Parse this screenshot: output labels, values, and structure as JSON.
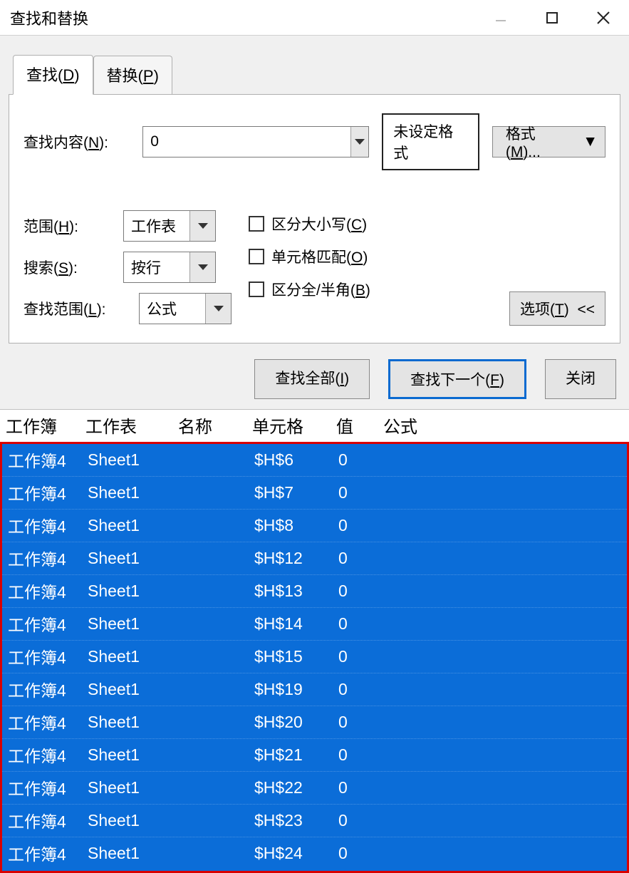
{
  "titlebar": {
    "title": "查找和替换"
  },
  "tabs": {
    "find": "查找(D)",
    "replace": "替换(P)"
  },
  "find": {
    "content_label": "查找内容(N):",
    "content_value": "0",
    "no_format_label": "未设定格式",
    "format_button": "格式(M)..."
  },
  "options": {
    "scope_label": "范围(H):",
    "scope_value": "工作表",
    "search_label": "搜索(S):",
    "search_value": "按行",
    "lookin_label": "查找范围(L):",
    "lookin_value": "公式",
    "chk_case": "区分大小写(C)",
    "chk_wholecell": "单元格匹配(O)",
    "chk_width": "区分全/半角(B)",
    "options_button": "选项(T)  <<"
  },
  "actions": {
    "find_all": "查找全部(I)",
    "find_next": "查找下一个(F)",
    "close": "关闭"
  },
  "results": {
    "headers": {
      "book": "工作簿",
      "sheet": "工作表",
      "name": "名称",
      "cell": "单元格",
      "value": "值",
      "formula": "公式"
    },
    "rows": [
      {
        "book": "工作簿4",
        "sheet": "Sheet1",
        "name": "",
        "cell": "$H$6",
        "value": "0",
        "formula": ""
      },
      {
        "book": "工作簿4",
        "sheet": "Sheet1",
        "name": "",
        "cell": "$H$7",
        "value": "0",
        "formula": ""
      },
      {
        "book": "工作簿4",
        "sheet": "Sheet1",
        "name": "",
        "cell": "$H$8",
        "value": "0",
        "formula": ""
      },
      {
        "book": "工作簿4",
        "sheet": "Sheet1",
        "name": "",
        "cell": "$H$12",
        "value": "0",
        "formula": ""
      },
      {
        "book": "工作簿4",
        "sheet": "Sheet1",
        "name": "",
        "cell": "$H$13",
        "value": "0",
        "formula": ""
      },
      {
        "book": "工作簿4",
        "sheet": "Sheet1",
        "name": "",
        "cell": "$H$14",
        "value": "0",
        "formula": ""
      },
      {
        "book": "工作簿4",
        "sheet": "Sheet1",
        "name": "",
        "cell": "$H$15",
        "value": "0",
        "formula": ""
      },
      {
        "book": "工作簿4",
        "sheet": "Sheet1",
        "name": "",
        "cell": "$H$19",
        "value": "0",
        "formula": ""
      },
      {
        "book": "工作簿4",
        "sheet": "Sheet1",
        "name": "",
        "cell": "$H$20",
        "value": "0",
        "formula": ""
      },
      {
        "book": "工作簿4",
        "sheet": "Sheet1",
        "name": "",
        "cell": "$H$21",
        "value": "0",
        "formula": ""
      },
      {
        "book": "工作簿4",
        "sheet": "Sheet1",
        "name": "",
        "cell": "$H$22",
        "value": "0",
        "formula": ""
      },
      {
        "book": "工作簿4",
        "sheet": "Sheet1",
        "name": "",
        "cell": "$H$23",
        "value": "0",
        "formula": ""
      },
      {
        "book": "工作簿4",
        "sheet": "Sheet1",
        "name": "",
        "cell": "$H$24",
        "value": "0",
        "formula": ""
      }
    ]
  }
}
